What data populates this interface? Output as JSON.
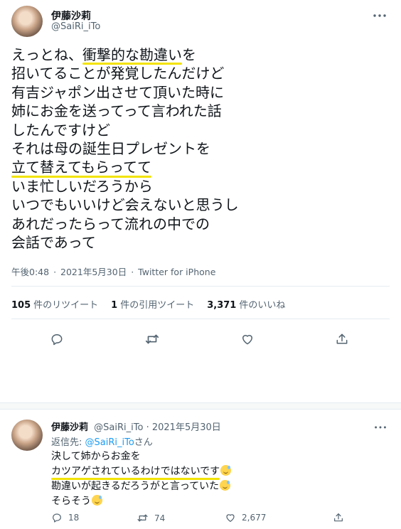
{
  "tweet": {
    "display_name": "伊藤沙莉",
    "handle": "@SaiRi_iTo",
    "lines": [
      {
        "before": "えっとね、",
        "highlight": "衝撃的な勘違い",
        "after": "を"
      },
      {
        "before": "招いてることが発覚したんだけど",
        "highlight": "",
        "after": ""
      },
      {
        "before": "有吉ジャポン出させて頂いた時に",
        "highlight": "",
        "after": ""
      },
      {
        "before": "姉にお金を送ってって言われた話",
        "highlight": "",
        "after": ""
      },
      {
        "before": "したんですけど",
        "highlight": "",
        "after": ""
      },
      {
        "before": "それは母の誕生日プレゼントを",
        "highlight": "",
        "after": ""
      },
      {
        "before": "",
        "highlight": "立て替えてもらってて",
        "after": ""
      },
      {
        "before": "いま忙しいだろうから",
        "highlight": "",
        "after": ""
      },
      {
        "before": "いつでもいいけど会えないと思うし",
        "highlight": "",
        "after": ""
      },
      {
        "before": "あれだったらって流れの中での",
        "highlight": "",
        "after": ""
      },
      {
        "before": "会話であって",
        "highlight": "",
        "after": ""
      }
    ],
    "time": "午後0:48",
    "date": "2021年5月30日",
    "source": "Twitter for iPhone",
    "separator": "·",
    "stats": {
      "retweets_count": "105",
      "retweets_label": "件のリツイート",
      "quotes_count": "1",
      "quotes_label": "件の引用ツイート",
      "likes_count": "3,371",
      "likes_label": "件のいいね"
    }
  },
  "reply": {
    "display_name": "伊藤沙莉",
    "handle": "@SaiRi_iTo",
    "separator": "·",
    "date": "2021年5月30日",
    "reply_to_prefix": "返信先: ",
    "reply_to_mention": "@SaiRi_iTo",
    "reply_to_suffix": "さん",
    "lines": [
      {
        "text": "決して姉からお金を",
        "highlight": "",
        "emoji": false
      },
      {
        "text": "",
        "highlight": "カツアゲされているわけではないです",
        "emoji": true
      },
      {
        "text": "勘違いが起きるだろうがと言っていた",
        "highlight": "",
        "emoji": true
      },
      {
        "text": "そらそう",
        "highlight": "",
        "emoji": true
      }
    ],
    "reply_count": "18",
    "retweet_count": "74",
    "like_count": "2,677"
  },
  "colors": {
    "highlight": "#f2e300",
    "link": "#1d9bf0",
    "secondary_text": "#536471",
    "primary_text": "#0f1419"
  },
  "icons": {
    "more": "more-icon",
    "reply": "reply-icon",
    "retweet": "retweet-icon",
    "like": "heart-icon",
    "share": "share-icon",
    "emoji": "grinning-sweat-emoji"
  }
}
